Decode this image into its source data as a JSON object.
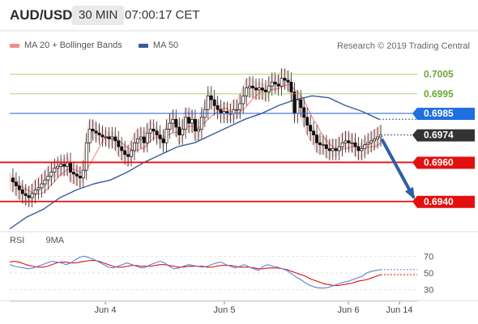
{
  "header": {
    "symbol": "AUD/USD",
    "timeframe": "30 MIN",
    "time": "07:00:17 CET"
  },
  "legend": {
    "ma_bands_label": "MA 20 + Bollinger Bands",
    "ma50_label": "MA 50",
    "ma_bands_color": "#f28b8b",
    "ma50_color": "#3a5a9c"
  },
  "credit": "Research © 2019 Trading Central",
  "rsi_legend": {
    "rsi_label": "RSI",
    "ma9_label": "9MA",
    "rsi_color": "#5b7fd6",
    "ma9_color": "#e31010"
  },
  "chart_data": {
    "type": "candlestick",
    "y_range": [
      0.6925,
      0.7014
    ],
    "levels": [
      {
        "value": 0.7005,
        "label": "0.7005",
        "kind": "resistance-green",
        "color": "#7cb342"
      },
      {
        "value": 0.6995,
        "label": "0.6995",
        "kind": "resistance-green",
        "color": "#7cb342"
      },
      {
        "value": 0.6985,
        "label": "0.6985",
        "kind": "ma50-level",
        "color": "#1f6fe0"
      },
      {
        "value": 0.6974,
        "label": "0.6974",
        "kind": "last-price",
        "color": "#333333"
      },
      {
        "value": 0.696,
        "label": "0.6960",
        "kind": "support-red",
        "color": "#e31010"
      },
      {
        "value": 0.694,
        "label": "0.6940",
        "kind": "support-red",
        "color": "#e31010"
      }
    ],
    "close_series": [
      0.6952,
      0.695,
      0.6948,
      0.6946,
      0.6944,
      0.6943,
      0.6942,
      0.6944,
      0.6946,
      0.6947,
      0.6949,
      0.6951,
      0.6953,
      0.6955,
      0.6957,
      0.6958,
      0.6959,
      0.6958,
      0.696,
      0.6955,
      0.6954,
      0.6953,
      0.6952,
      0.6956,
      0.697,
      0.6977,
      0.6976,
      0.6975,
      0.6974,
      0.6973,
      0.6973,
      0.6972,
      0.6973,
      0.6971,
      0.6968,
      0.6966,
      0.6964,
      0.6963,
      0.6966,
      0.697,
      0.6972,
      0.6973,
      0.697,
      0.6975,
      0.6977,
      0.6976,
      0.6974,
      0.6972,
      0.697,
      0.6977,
      0.698,
      0.6982,
      0.6978,
      0.6974,
      0.6977,
      0.6983,
      0.698,
      0.6982,
      0.6976,
      0.6977,
      0.6983,
      0.6987,
      0.6994,
      0.6992,
      0.6989,
      0.6987,
      0.6985,
      0.6986,
      0.6985,
      0.6985,
      0.6987,
      0.6987,
      0.699,
      0.6994,
      0.6998,
      0.6999,
      0.6998,
      0.6997,
      0.6998,
      0.6997,
      0.6996,
      0.6999,
      0.7001,
      0.7,
      0.6999,
      0.7003,
      0.7002,
      0.7001,
      0.6996,
      0.6985,
      0.6992,
      0.6988,
      0.6983,
      0.6979,
      0.6976,
      0.6974,
      0.697,
      0.6969,
      0.6969,
      0.6967,
      0.6966,
      0.6967,
      0.6966,
      0.6968,
      0.697,
      0.6971,
      0.697,
      0.697,
      0.6968,
      0.6966,
      0.6967,
      0.6969,
      0.697,
      0.6971,
      0.6972,
      0.6973,
      0.6974
    ],
    "ma50_series": [
      0.6926,
      0.6932,
      0.6936,
      0.6942,
      0.6946,
      0.6949,
      0.6951,
      0.6955,
      0.696,
      0.6964,
      0.6968,
      0.697,
      0.6974,
      0.6978,
      0.6982,
      0.6985,
      0.6989,
      0.6992,
      0.6994,
      0.6993,
      0.6989,
      0.6986,
      0.6982
    ],
    "forecast": {
      "from": 0.6973,
      "to": 0.694
    },
    "x_ticks": [
      "Jun 4",
      "Jun 5",
      "Jun 6",
      "Jun 14"
    ],
    "rsi": {
      "ticks": [
        70,
        50,
        30
      ],
      "rsi_series": [
        60,
        58,
        57,
        56,
        55,
        56,
        58,
        60,
        62,
        64,
        63,
        62,
        60,
        62,
        66,
        69,
        70,
        68,
        66,
        63,
        60,
        57,
        56,
        58,
        60,
        62,
        60,
        58,
        56,
        57,
        60,
        62,
        64,
        62,
        58,
        55,
        56,
        58,
        60,
        59,
        58,
        57,
        58,
        60,
        62,
        63,
        60,
        58,
        56,
        58,
        60,
        57,
        55,
        53,
        58,
        60,
        58,
        57,
        55,
        53,
        49,
        45,
        42,
        38,
        35,
        33,
        32,
        32,
        33,
        35,
        37,
        39,
        40,
        42,
        44,
        46,
        50,
        52,
        53,
        54
      ],
      "ma9_series": [
        63,
        64,
        63,
        61,
        59,
        58,
        57,
        57,
        58,
        60,
        62,
        63,
        63,
        62,
        62,
        63,
        64,
        65,
        65,
        64,
        62,
        60,
        58,
        57,
        57,
        58,
        59,
        59,
        58,
        58,
        58,
        59,
        60,
        60,
        59,
        58,
        57,
        57,
        58,
        58,
        58,
        58,
        57,
        57,
        58,
        59,
        59,
        59,
        58,
        57,
        57,
        57,
        56,
        55,
        55,
        56,
        56,
        56,
        55,
        54,
        52,
        50,
        48,
        46,
        43,
        41,
        39,
        37,
        36,
        35,
        35,
        36,
        37,
        38,
        40,
        41,
        42,
        44,
        46,
        48
      ]
    }
  }
}
